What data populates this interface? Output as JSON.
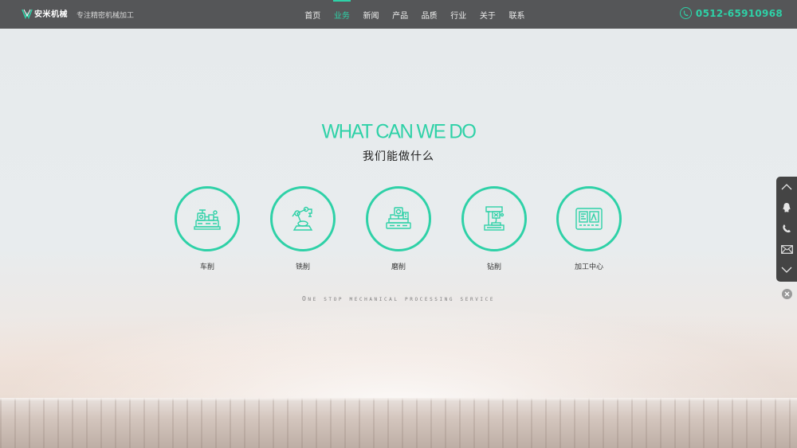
{
  "brand": {
    "name": "安米机械",
    "slogan": "专注精密机械加工",
    "accent_color": "#2ed1a7"
  },
  "nav": {
    "items": [
      {
        "label": "首页",
        "active": false
      },
      {
        "label": "业务",
        "active": true
      },
      {
        "label": "新闻",
        "active": false
      },
      {
        "label": "产品",
        "active": false
      },
      {
        "label": "品质",
        "active": false
      },
      {
        "label": "行业",
        "active": false
      },
      {
        "label": "关于",
        "active": false
      },
      {
        "label": "联系",
        "active": false
      }
    ]
  },
  "contact": {
    "phone": "0512-65910968",
    "icon": "phone-icon"
  },
  "hero": {
    "title_en": "WHAT CAN WE DO",
    "title_cn": "我们能做什么",
    "tagline": "One stop mechanical processing service"
  },
  "services": [
    {
      "label": "车削",
      "icon": "lathe-icon"
    },
    {
      "label": "铣削",
      "icon": "milling-robot-icon"
    },
    {
      "label": "磨削",
      "icon": "grinding-machine-icon"
    },
    {
      "label": "钻削",
      "icon": "drilling-machine-icon"
    },
    {
      "label": "加工中心",
      "icon": "machining-center-icon"
    }
  ],
  "side_panel": {
    "buttons": [
      "scroll-up-icon",
      "qq-icon",
      "phone-icon",
      "mail-icon",
      "scroll-down-icon"
    ],
    "close_icon": "close-icon"
  }
}
